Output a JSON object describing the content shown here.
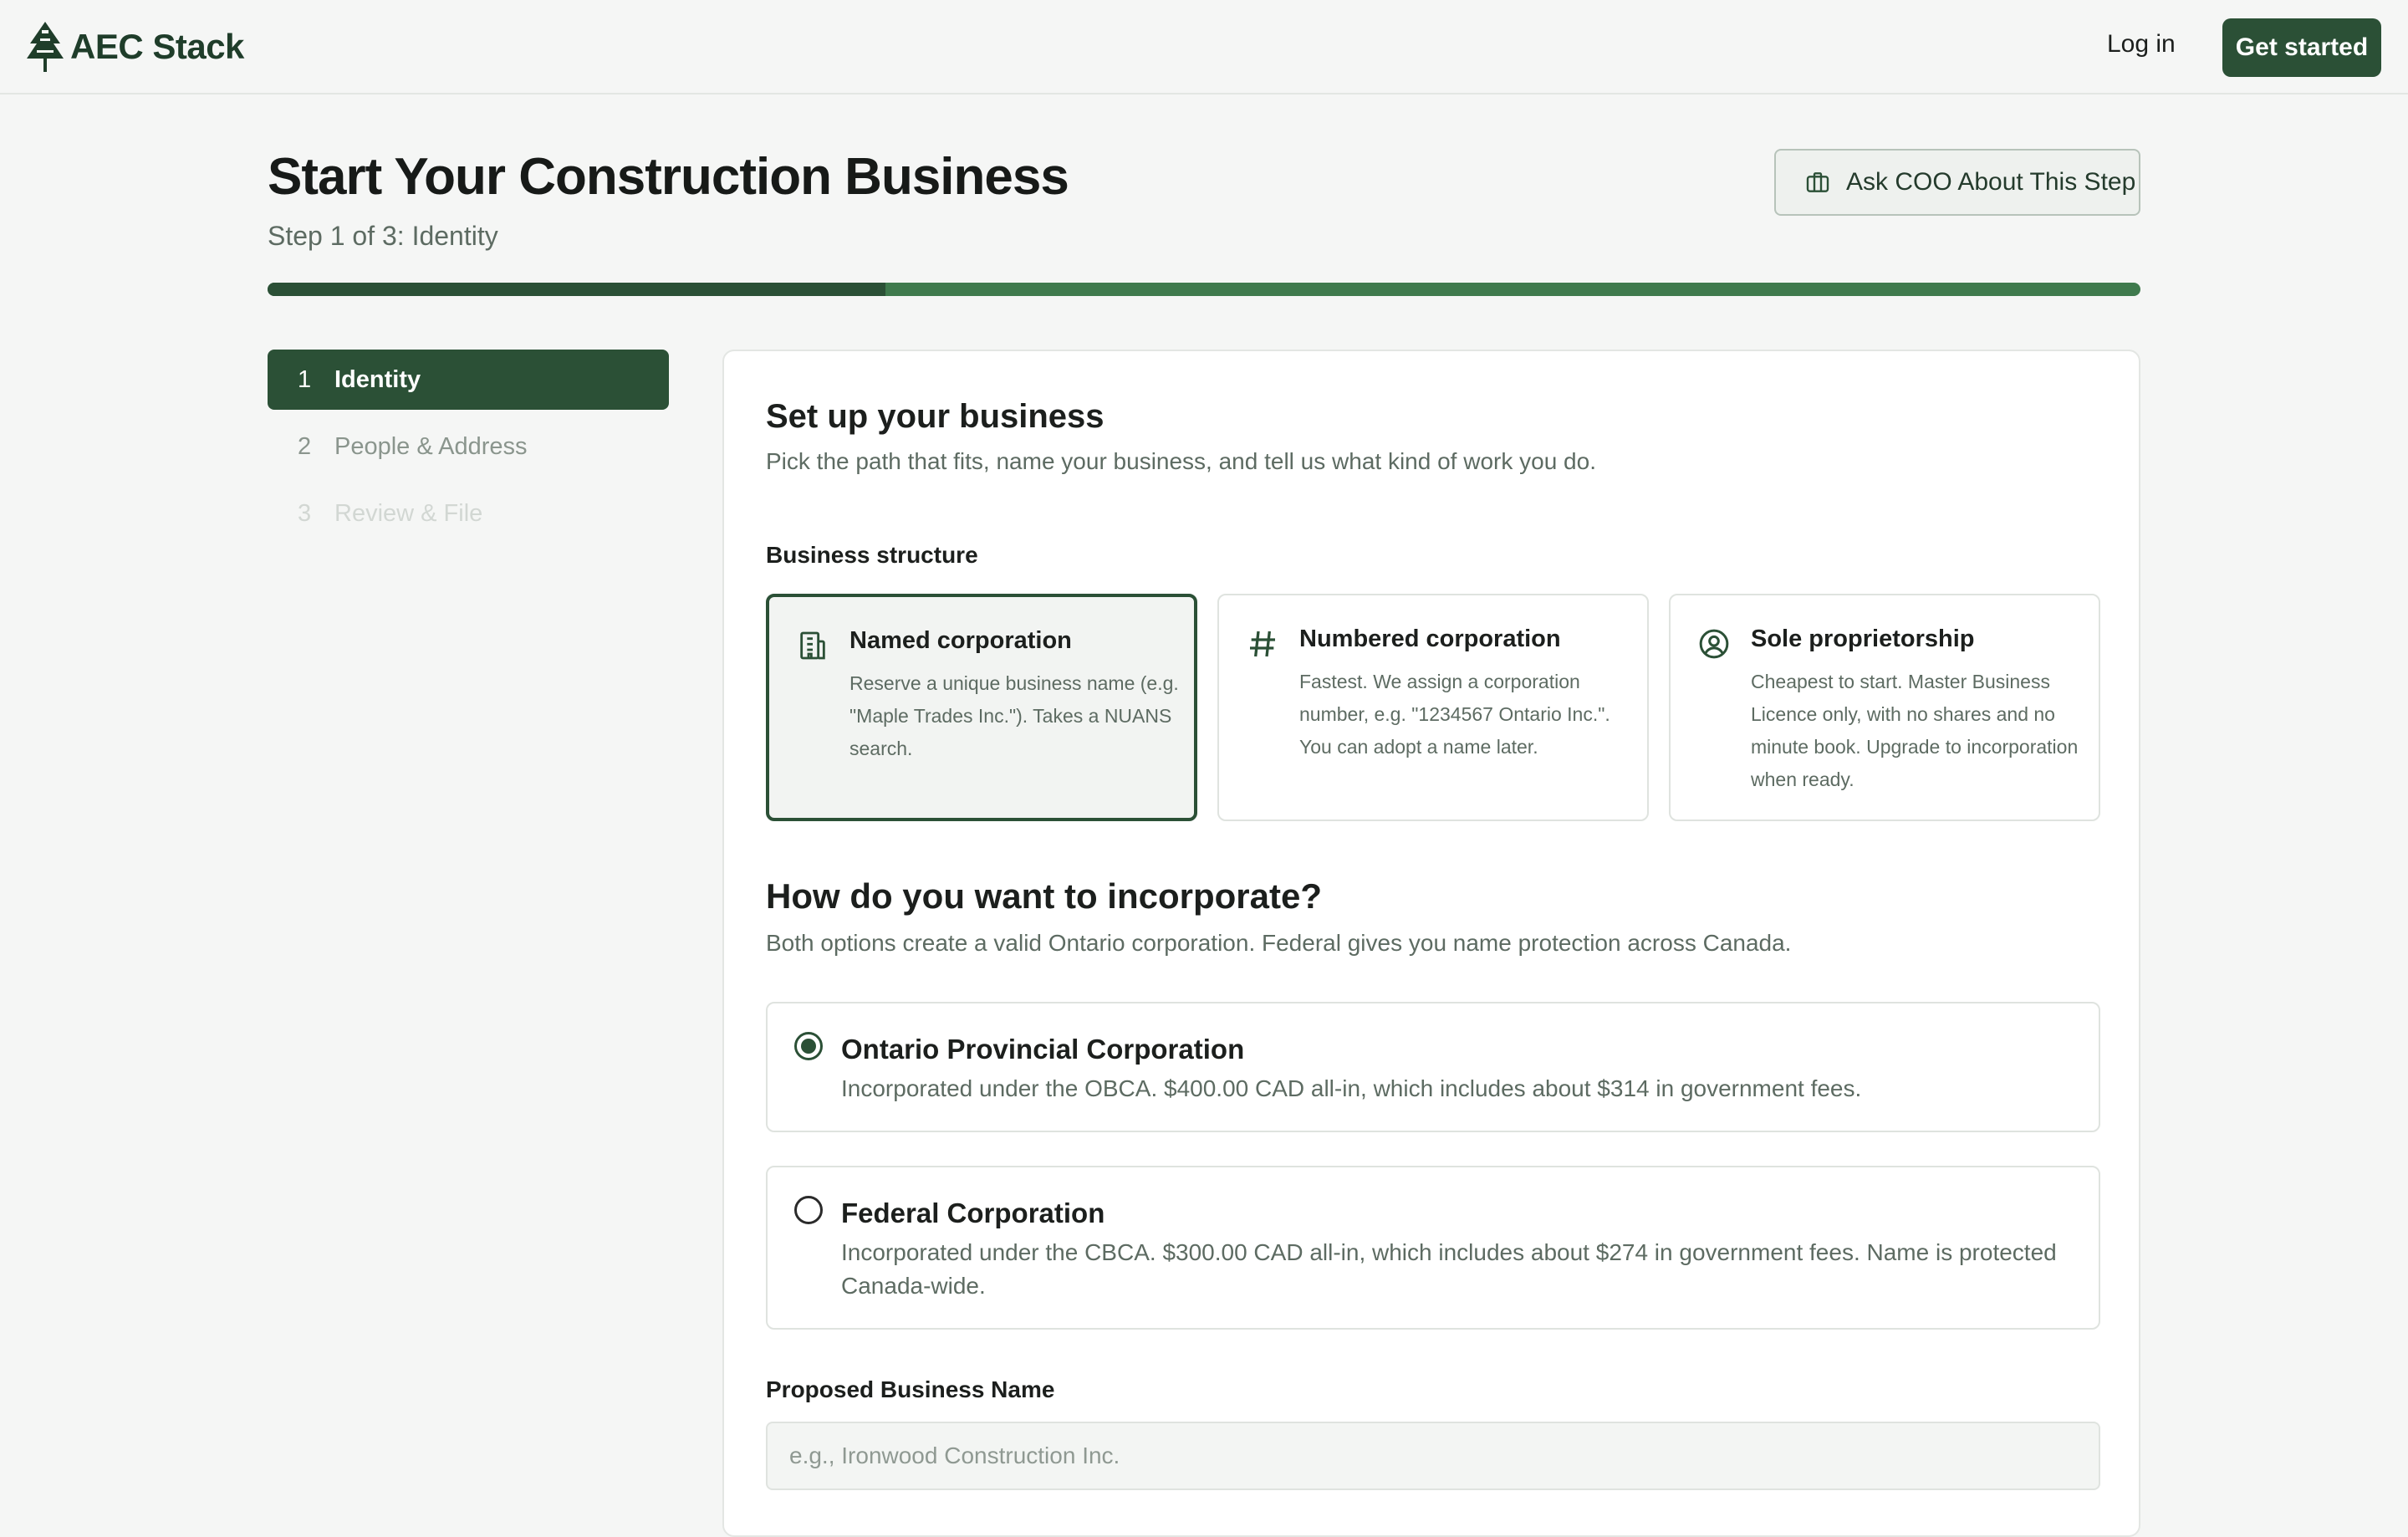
{
  "header": {
    "logo_text": "AEC Stack",
    "login_label": "Log in",
    "cta_label": "Get started"
  },
  "page": {
    "title": "Start Your Construction Business",
    "subtitle": "Step 1 of 3: Identity",
    "ask_label": "Ask COO About This Step",
    "progress_fraction": 0.33
  },
  "steps": [
    {
      "num": "1",
      "label": "Identity",
      "state": "active"
    },
    {
      "num": "2",
      "label": "People & Address",
      "state": "upcoming"
    },
    {
      "num": "3",
      "label": "Review & File",
      "state": "disabled"
    }
  ],
  "form": {
    "title": "Set up your business",
    "subtitle": "Pick the path that fits, name your business, and tell us what kind of work you do.",
    "structure_label": "Business structure",
    "structure_options": [
      {
        "icon": "building-icon",
        "title": "Named corporation",
        "desc": "Reserve a unique business name (e.g. \"Maple Trades Inc.\"). Takes a NUANS search.",
        "selected": true
      },
      {
        "icon": "hash-icon",
        "title": "Numbered corporation",
        "desc": "Fastest. We assign a corporation number, e.g. \"1234567 Ontario Inc.\". You can adopt a name later.",
        "selected": false
      },
      {
        "icon": "user-circle-icon",
        "title": "Sole proprietorship",
        "desc": "Cheapest to start. Master Business Licence only, with no shares and no minute book. Upgrade to incorporation when ready.",
        "selected": false
      }
    ],
    "incorporate_title": "How do you want to incorporate?",
    "incorporate_subtitle": "Both options create a valid Ontario corporation. Federal gives you name protection across Canada.",
    "incorporate_options": [
      {
        "title": "Ontario Provincial Corporation",
        "desc": "Incorporated under the OBCA. $400.00 CAD all-in, which includes about $314 in government fees.",
        "selected": true
      },
      {
        "title": "Federal Corporation",
        "desc": "Incorporated under the CBCA. $300.00 CAD all-in, which includes about $274 in government fees. Name is protected Canada-wide.",
        "selected": false
      }
    ],
    "name_label": "Proposed Business Name",
    "name_placeholder": "e.g., Ironwood Construction Inc.",
    "name_value": ""
  },
  "colors": {
    "brand": "#2b5036",
    "progress_track": "#3f7a4d",
    "muted_text": "#5d6b62"
  }
}
